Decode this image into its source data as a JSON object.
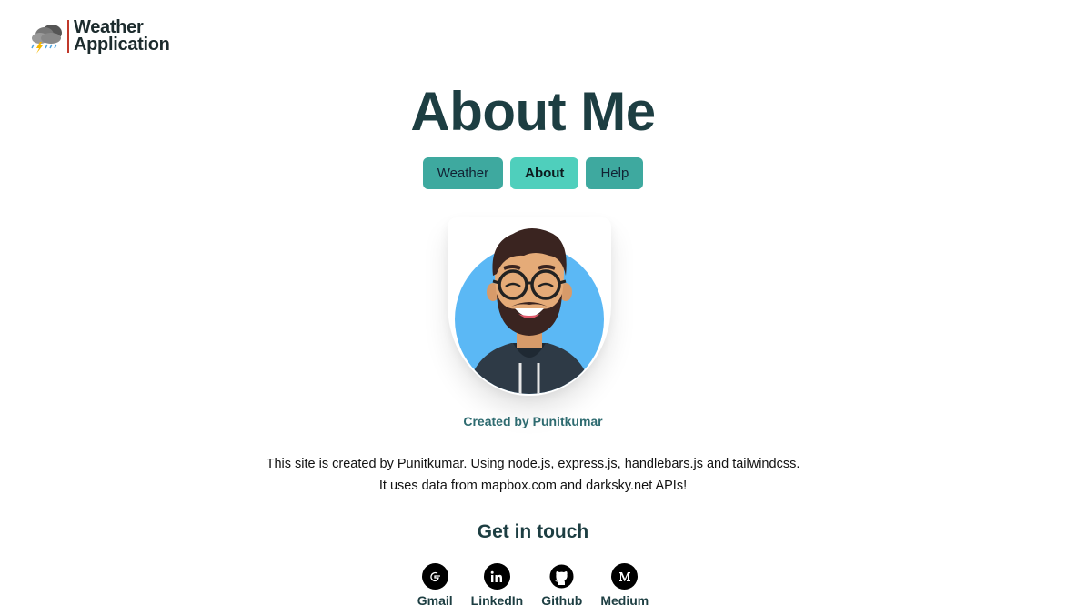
{
  "logo": {
    "line1": "Weather",
    "line2": "Application",
    "icon": "storm-cloud-icon"
  },
  "title": "About Me",
  "nav": [
    {
      "label": "Weather",
      "active": false
    },
    {
      "label": "About",
      "active": true
    },
    {
      "label": "Help",
      "active": false
    }
  ],
  "credit": "Created by Punitkumar",
  "description": {
    "line1": "This site is created by Punitkumar. Using node.js, express.js, handlebars.js and tailwindcss.",
    "line2": "It uses data from mapbox.com and darksky.net APIs!"
  },
  "contact_heading": "Get in touch",
  "socials": [
    {
      "label": "Gmail",
      "icon": "google-icon"
    },
    {
      "label": "LinkedIn",
      "icon": "linkedin-icon"
    },
    {
      "label": "Github",
      "icon": "github-icon"
    },
    {
      "label": "Medium",
      "icon": "medium-icon"
    }
  ],
  "colors": {
    "accent": "#3ea99f",
    "active": "#4fcfbc",
    "heading": "#1d3e42"
  }
}
